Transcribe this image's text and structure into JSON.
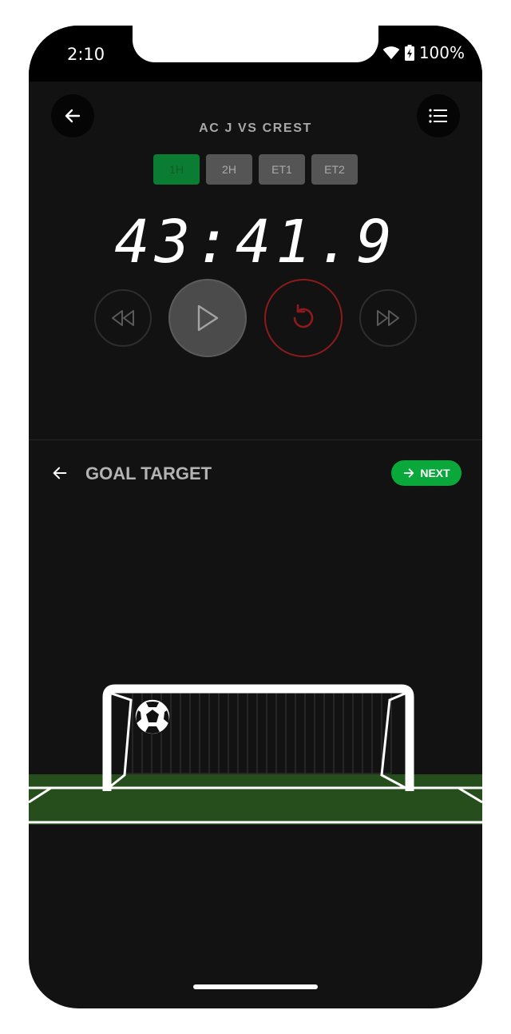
{
  "status_bar": {
    "time": "2:10",
    "battery": "100%",
    "icons": [
      "wifi-icon",
      "battery-icon"
    ]
  },
  "header": {
    "back_icon": "arrow-left-icon",
    "menu_icon": "list-icon"
  },
  "match": {
    "title": "AC J VS CREST",
    "periods": [
      {
        "label": "1H",
        "active": true
      },
      {
        "label": "2H",
        "active": false
      },
      {
        "label": "ET1",
        "active": false
      },
      {
        "label": "ET2",
        "active": false
      }
    ],
    "clock": "43:41.9"
  },
  "controls": {
    "icons": [
      "rewind-icon",
      "play-icon",
      "reset-icon",
      "fast-forward-icon"
    ],
    "reset_color": "#8e1b1b"
  },
  "section": {
    "title": "GOAL TARGET",
    "next_label": "NEXT",
    "next_color": "#0aa83a"
  },
  "pitch": {
    "grass_color": "#264d1c"
  }
}
